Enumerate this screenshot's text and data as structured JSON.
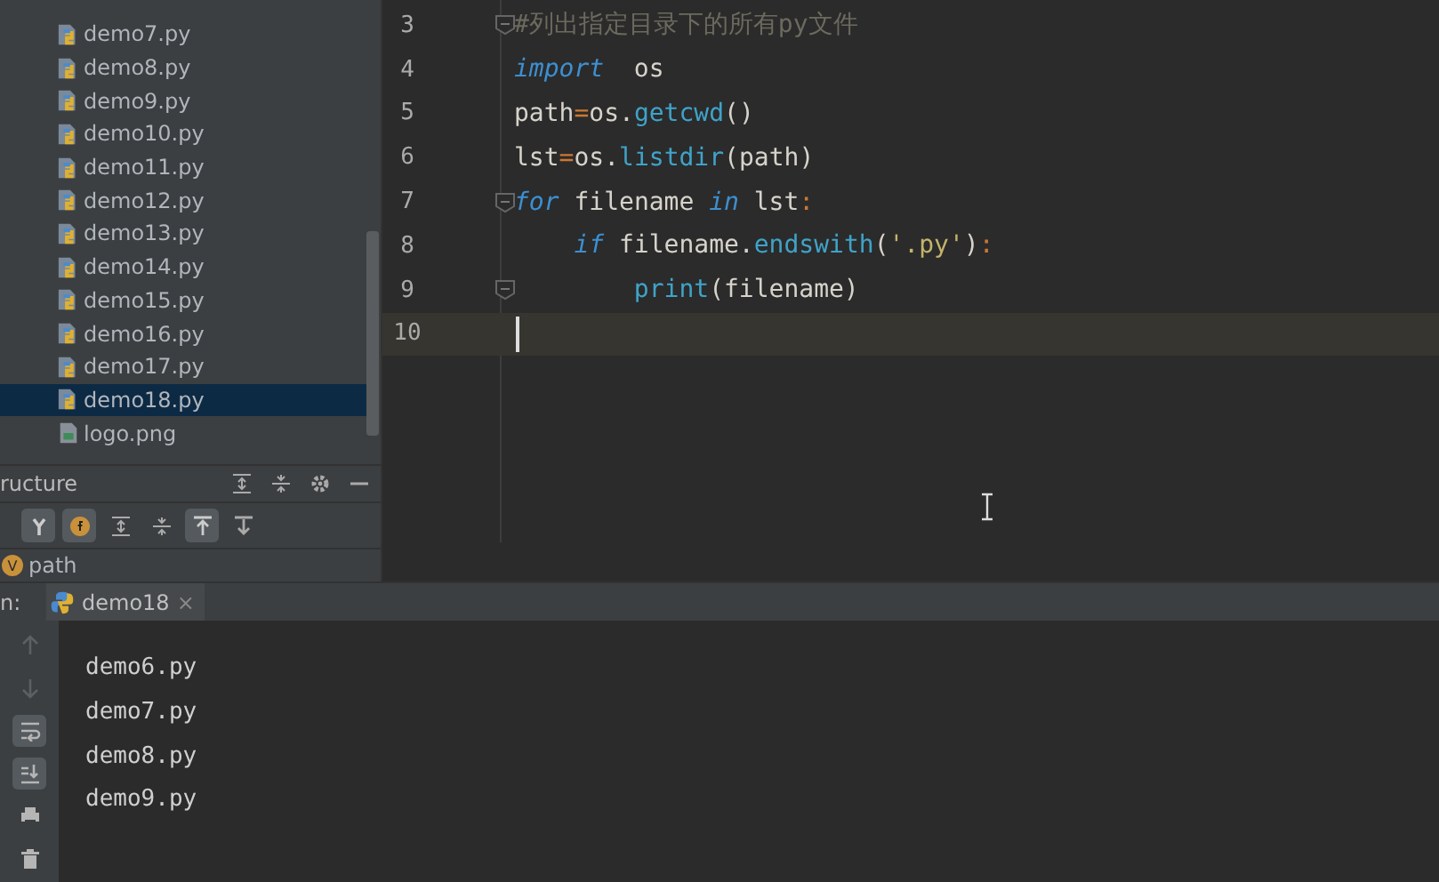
{
  "project_tree": {
    "items": [
      {
        "label": "demo7.py",
        "kind": "python",
        "selected": false
      },
      {
        "label": "demo8.py",
        "kind": "python",
        "selected": false
      },
      {
        "label": "demo9.py",
        "kind": "python",
        "selected": false
      },
      {
        "label": "demo10.py",
        "kind": "python",
        "selected": false
      },
      {
        "label": "demo11.py",
        "kind": "python",
        "selected": false
      },
      {
        "label": "demo12.py",
        "kind": "python",
        "selected": false
      },
      {
        "label": "demo13.py",
        "kind": "python",
        "selected": false
      },
      {
        "label": "demo14.py",
        "kind": "python",
        "selected": false
      },
      {
        "label": "demo15.py",
        "kind": "python",
        "selected": false
      },
      {
        "label": "demo16.py",
        "kind": "python",
        "selected": false
      },
      {
        "label": "demo17.py",
        "kind": "python",
        "selected": false
      },
      {
        "label": "demo18.py",
        "kind": "python",
        "selected": true
      },
      {
        "label": "logo.png",
        "kind": "image",
        "selected": false
      }
    ]
  },
  "structure": {
    "title": "ructure",
    "toolbar": [
      {
        "on": true
      },
      {
        "on": true
      },
      {
        "on": false
      },
      {
        "on": false
      },
      {
        "on": true
      },
      {
        "on": false
      }
    ],
    "items": [
      {
        "badge": "V",
        "label": "path"
      }
    ]
  },
  "editor": {
    "lines": [
      {
        "number": "3",
        "fold": true,
        "current": false,
        "tokens": [
          {
            "text": "#列出指定目录下的所有py文件",
            "kind": "comment"
          }
        ]
      },
      {
        "number": "4",
        "fold": false,
        "current": false,
        "tokens": [
          {
            "text": "import",
            "kind": "keyword"
          },
          {
            "text": "  os",
            "kind": "plain"
          }
        ]
      },
      {
        "number": "5",
        "fold": false,
        "current": false,
        "tokens": [
          {
            "text": "path",
            "kind": "plain"
          },
          {
            "text": "=",
            "kind": "op"
          },
          {
            "text": "os.",
            "kind": "plain"
          },
          {
            "text": "getcwd",
            "kind": "func"
          },
          {
            "text": "()",
            "kind": "plain"
          }
        ]
      },
      {
        "number": "6",
        "fold": false,
        "current": false,
        "tokens": [
          {
            "text": "lst",
            "kind": "plain"
          },
          {
            "text": "=",
            "kind": "op"
          },
          {
            "text": "os.",
            "kind": "plain"
          },
          {
            "text": "listdir",
            "kind": "func"
          },
          {
            "text": "(path)",
            "kind": "plain"
          }
        ]
      },
      {
        "number": "7",
        "fold": true,
        "current": false,
        "tokens": [
          {
            "text": "for",
            "kind": "keyword"
          },
          {
            "text": " filename ",
            "kind": "plain"
          },
          {
            "text": "in",
            "kind": "keyword"
          },
          {
            "text": " lst",
            "kind": "plain"
          },
          {
            "text": ":",
            "kind": "op"
          }
        ]
      },
      {
        "number": "8",
        "fold": false,
        "current": false,
        "tokens": [
          {
            "text": "    if",
            "kind": "keyword"
          },
          {
            "text": " filename.",
            "kind": "plain"
          },
          {
            "text": "endswith",
            "kind": "func"
          },
          {
            "text": "(",
            "kind": "plain"
          },
          {
            "text": "'.py'",
            "kind": "string"
          },
          {
            "text": ")",
            "kind": "plain"
          },
          {
            "text": ":",
            "kind": "op"
          }
        ]
      },
      {
        "number": "9",
        "fold": true,
        "current": false,
        "tokens": [
          {
            "text": "        print",
            "kind": "func"
          },
          {
            "text": "(filename)",
            "kind": "plain"
          }
        ]
      },
      {
        "number": "10",
        "fold": false,
        "current": true
      }
    ]
  },
  "run_panel": {
    "label": "n:",
    "tab": {
      "title": "demo18",
      "close": "×"
    },
    "toolbar": [
      {
        "disabled": true,
        "on": false
      },
      {
        "disabled": true,
        "on": false
      },
      {
        "disabled": false,
        "on": true
      },
      {
        "disabled": false,
        "on": true
      },
      {
        "disabled": false,
        "on": false
      },
      {
        "disabled": false,
        "on": false
      }
    ],
    "output": [
      "demo6.py",
      "demo7.py",
      "demo8.py",
      "demo9.py"
    ]
  }
}
